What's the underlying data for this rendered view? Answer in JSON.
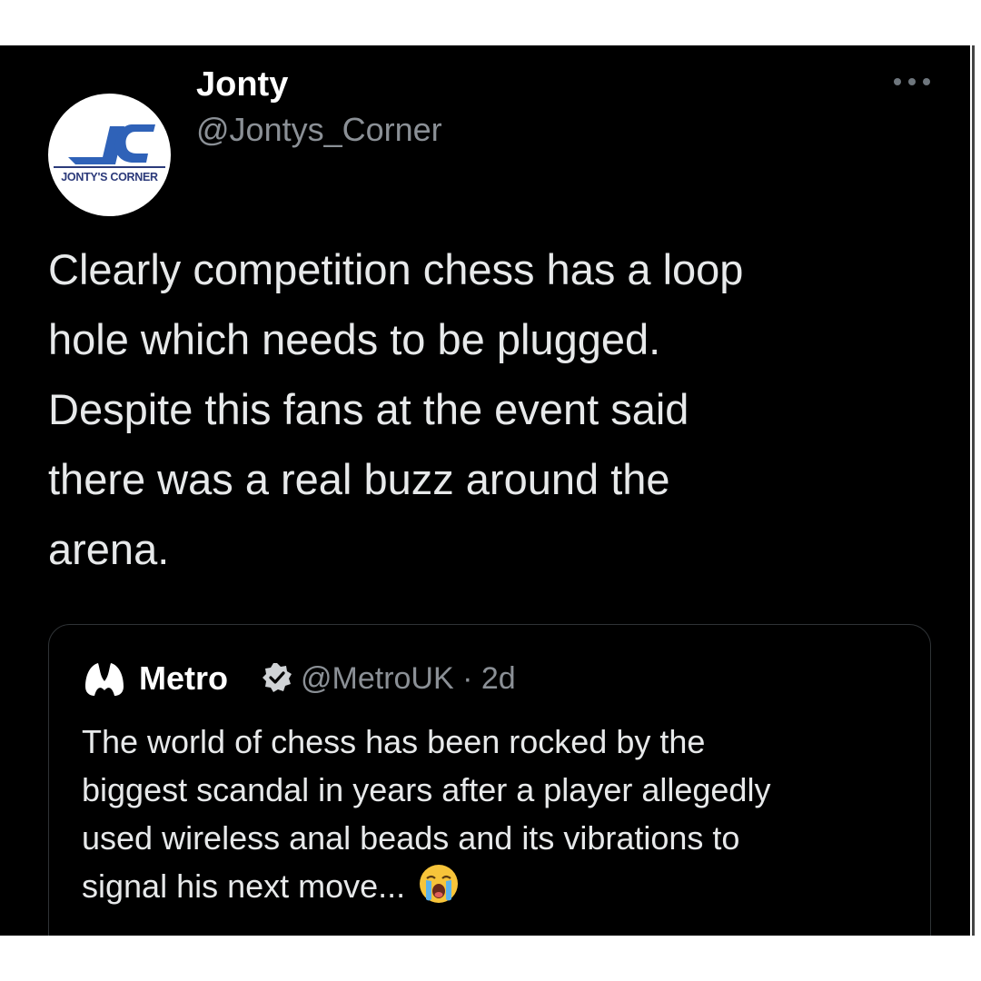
{
  "tweet": {
    "author": {
      "display_name": "Jonty",
      "handle": "@Jontys_Corner",
      "avatar_text": "JONTY'S CORNER",
      "avatar_initials": "JC"
    },
    "more_icon": "more-horizontal-icon",
    "text_lines": [
      "Clearly competition chess has a loop",
      "hole which needs to be plugged.",
      "Despite this fans at the event said",
      "there was a real buzz around the",
      "arena."
    ]
  },
  "quote": {
    "logo_icon": "metro-logo-icon",
    "display_name": "Metro",
    "verified_icon": "verified-badge-icon",
    "handle_time": "@MetroUK · 2d",
    "text_lines": [
      "The world of chess has been rocked by the",
      "biggest scandal in years after a player allegedly",
      "used wireless anal beads and its vibrations to",
      "signal his next move..."
    ],
    "emoji": "loudly-crying-face-emoji"
  },
  "colors": {
    "background": "#000000",
    "text_primary": "#e7e9ea",
    "text_secondary": "#8b9096",
    "border": "#2f3336",
    "brand_blue": "#2f62b8"
  }
}
